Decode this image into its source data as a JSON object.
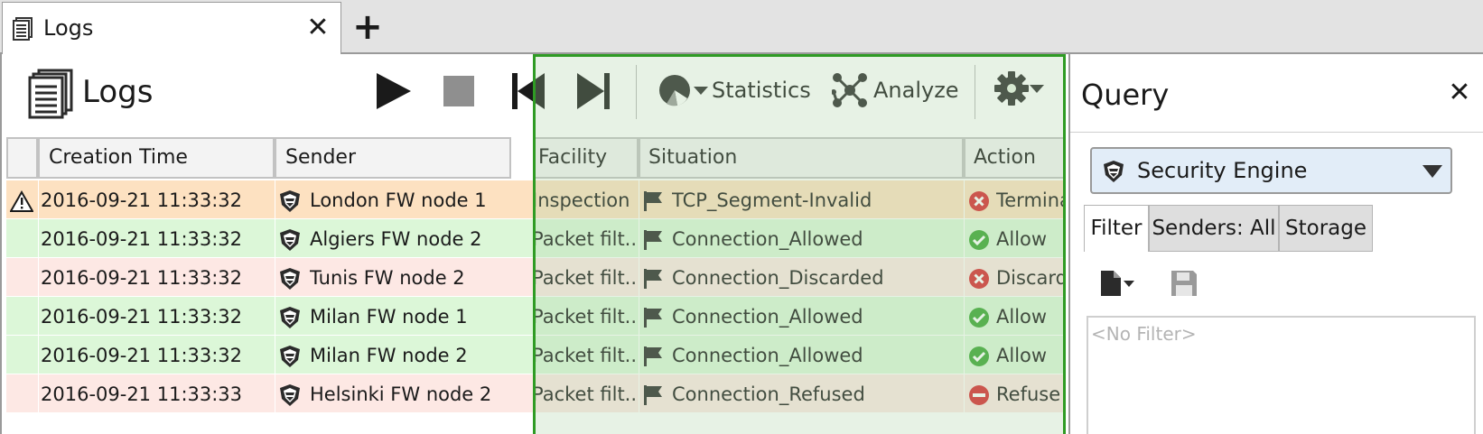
{
  "tab": {
    "label": "Logs",
    "close": "✕",
    "new_tab": "+"
  },
  "page": {
    "title": "Logs"
  },
  "toolbar": {
    "statistics_label": "Statistics",
    "analyze_label": "Analyze",
    "icons": [
      "play-icon",
      "stop-icon",
      "skip-first-icon",
      "skip-last-icon",
      "pie-chart-icon",
      "network-icon",
      "gear-icon"
    ],
    "highlight_color": "#2f9b24"
  },
  "table": {
    "columns": [
      "",
      "Creation Time",
      "Sender",
      "Facility",
      "Situation",
      "Action"
    ],
    "rows": [
      {
        "status": "warning",
        "time": "2016-09-21 11:33:32",
        "sender": "London FW node 1",
        "facility": "Inspection",
        "situation": "TCP_Segment-Invalid",
        "action": "Terminate",
        "action_icon": "terminate",
        "bg": "#fde1c1"
      },
      {
        "status": "",
        "time": "2016-09-21 11:33:32",
        "sender": "Algiers FW node 2",
        "facility": "Packet filt...",
        "situation": "Connection_Allowed",
        "action": "Allow",
        "action_icon": "allow",
        "bg": "#dcf7d8"
      },
      {
        "status": "",
        "time": "2016-09-21 11:33:32",
        "sender": "Tunis FW node 2",
        "facility": "Packet filt...",
        "situation": "Connection_Discarded",
        "action": "Discard",
        "action_icon": "discard",
        "bg": "#fde8e4"
      },
      {
        "status": "",
        "time": "2016-09-21 11:33:32",
        "sender": "Milan FW node 1",
        "facility": "Packet filt...",
        "situation": "Connection_Allowed",
        "action": "Allow",
        "action_icon": "allow",
        "bg": "#dcf7d8"
      },
      {
        "status": "",
        "time": "2016-09-21 11:33:32",
        "sender": "Milan FW node 2",
        "facility": "Packet filt...",
        "situation": "Connection_Allowed",
        "action": "Allow",
        "action_icon": "allow",
        "bg": "#dcf7d8"
      },
      {
        "status": "",
        "time": "2016-09-21 11:33:33",
        "sender": "Helsinki FW node 2",
        "facility": "Packet filt...",
        "situation": "Connection_Refused",
        "action": "Refuse",
        "action_icon": "refuse",
        "bg": "#fde8e4"
      }
    ]
  },
  "query": {
    "title": "Query",
    "close": "✕",
    "select_value": "Security Engine",
    "tabs": [
      "Filter",
      "Senders: All",
      "Storage"
    ],
    "filter_placeholder": "<No Filter>"
  }
}
